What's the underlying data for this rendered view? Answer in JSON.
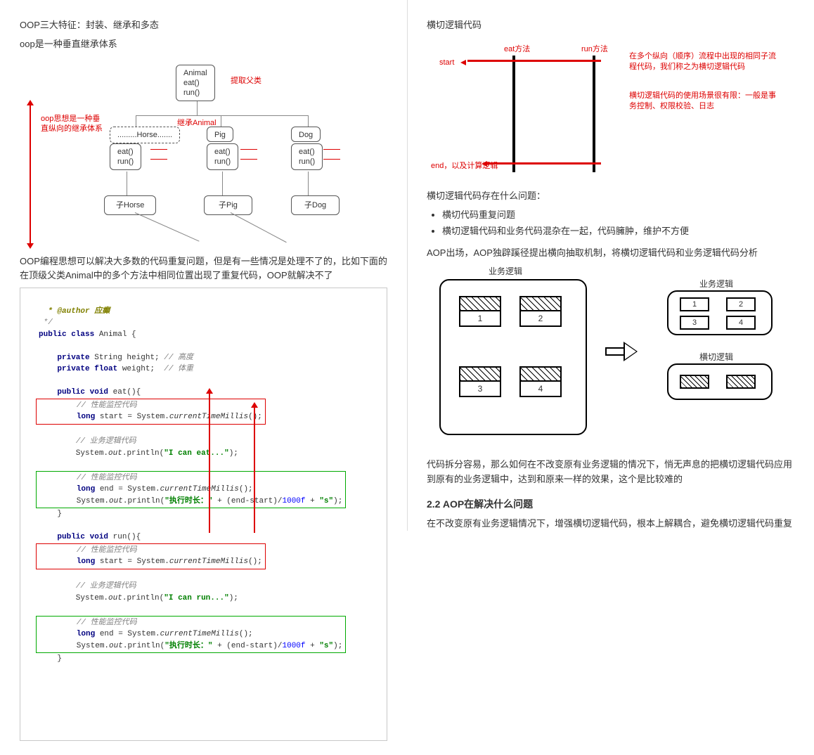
{
  "left": {
    "title1": "OOP三大特征：封装、继承和多态",
    "title2": "oop是一种垂直继承体系",
    "sidelabel": "oop思想是一种垂直纵向的继承体系",
    "extract": "提取父类",
    "inherit": "继承Animal",
    "animal": {
      "name": "Animal",
      "m1": "eat()",
      "m2": "run()"
    },
    "horse": {
      "name": ".........Horse.......",
      "m1": "eat()",
      "m2": "run()"
    },
    "pig": {
      "name": "Pig",
      "m1": "eat()",
      "m2": "run()"
    },
    "dog": {
      "name": "Dog",
      "m1": "eat()",
      "m2": "run()"
    },
    "sub_h": "子Horse",
    "sub_p": "子Pig",
    "sub_d": "子Dog",
    "para1": "OOP编程思想可以解决大多数的代码重复问题，但是有一些情况是处理不了的，比如下面的在顶级父类Animal中的多个方法中相同位置出现了重复代码，OOP就解决不了",
    "code_comment_author": "* @author 应癲",
    "code_comment_end": "*/",
    "code_class": "public class Animal {",
    "code_f1": "private String height; // 高度",
    "code_f2": "private float weight;  // 体重",
    "code_eat_sig": "public void eat(){",
    "code_run_sig": "public void run(){",
    "perf_label": "// 性能监控代码",
    "perf_start": "long start = System.currentTimeMillis();",
    "biz_label": "// 业务逻辑代码",
    "biz_eat": "System.out.println(\"I can eat...\");",
    "biz_run": "System.out.println(\"I can run...\");",
    "perf_end1": "long end = System.currentTimeMillis();",
    "perf_end2": "System.out.println(\"执行时长：\" + (end-start)/1000f + \"s\");"
  },
  "right": {
    "head1": "横切逻辑代码",
    "eat_m": "eat方法",
    "run_m": "run方法",
    "start": "start",
    "note1": "在多个纵向（顺序）流程中出现的相同子流程代码，我们称之为横切逻辑代码",
    "note2": "横切逻辑代码的使用场景很有限：一般是事务控制、权限校验、日志",
    "end_label": "end，以及计算逻辑",
    "q_head": "横切逻辑代码存在什么问题：",
    "q1": "横切代码重复问题",
    "q2": "横切逻辑代码和业务代码混杂在一起，代码臃肿，维护不方便",
    "aop_para": "AOP出场，AOP独辟蹊径提出横向抽取机制，将横切逻辑代码和业务逻辑代码分析",
    "biz_title": "业务逻辑",
    "cross_title": "横切逻辑",
    "c1": "1",
    "c2": "2",
    "c3": "3",
    "c4": "4",
    "split_para": "代码拆分容易，那么如何在不改变原有业务逻辑的情况下，悄无声息的把横切逻辑代码应用到原有的业务逻辑中，达到和原来一样的效果，这个是比较难的",
    "section22": "2.2 AOP在解决什么问题",
    "last": "在不改变原有业务逻辑情况下，增强横切逻辑代码，根本上解耦合，避免横切逻辑代码重复"
  }
}
